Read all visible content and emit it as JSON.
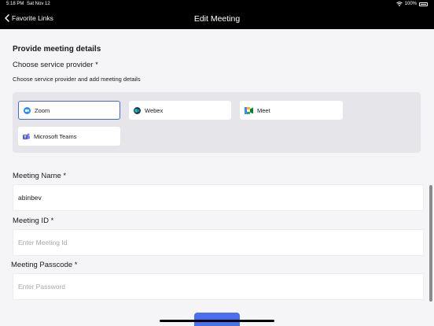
{
  "status_bar": {
    "time": "5:18 PM",
    "date": "Sat Nov 12",
    "battery": "100%"
  },
  "nav": {
    "back_label": "Favorite Links",
    "title": "Edit Meeting"
  },
  "form": {
    "heading": "Provide meeting details",
    "provider_label": "Choose service provider *",
    "provider_hint": "Choose service provider and add meeting details",
    "providers": [
      {
        "name": "Zoom",
        "icon": "zoom-icon",
        "selected": true
      },
      {
        "name": "Webex",
        "icon": "webex-icon",
        "selected": false
      },
      {
        "name": "Meet",
        "icon": "google-meet-icon",
        "selected": false
      },
      {
        "name": "Microsoft Teams",
        "icon": "microsoft-teams-icon",
        "selected": false
      }
    ],
    "meeting_name": {
      "label": "Meeting Name *",
      "value": "abinbev"
    },
    "meeting_id": {
      "label": "Meeting ID *",
      "placeholder": "Enter Meeting Id"
    },
    "passcode": {
      "label": "Meeting Passcode *",
      "placeholder": "Enter Password"
    }
  },
  "colors": {
    "accent": "#4a6ef0",
    "selected_border": "#4a63e0",
    "bar": "#000000",
    "panel": "#e6e6ea"
  }
}
